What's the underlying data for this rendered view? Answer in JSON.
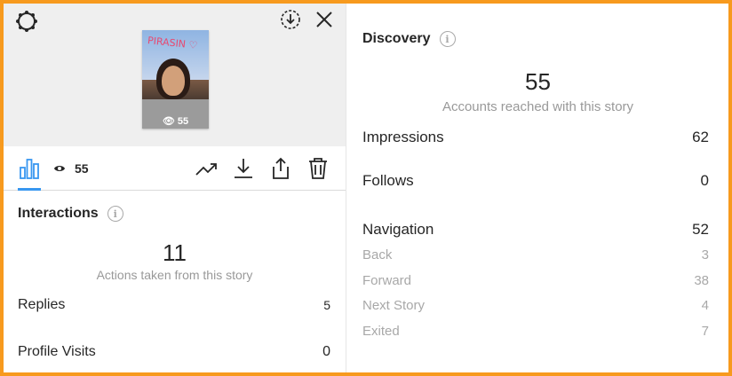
{
  "story": {
    "thumbnail_text": "PIRASIN ♡",
    "views": "55"
  },
  "toolbar": {
    "view_count": "55"
  },
  "interactions": {
    "title": "Interactions",
    "total": "11",
    "subtitle": "Actions taken from this story",
    "rows": [
      {
        "label": "Replies",
        "value": "5"
      },
      {
        "label": "Profile Visits",
        "value": "0"
      }
    ]
  },
  "discovery": {
    "title": "Discovery",
    "reach": "55",
    "subtitle": "Accounts reached with this story",
    "impressions": {
      "label": "Impressions",
      "value": "62"
    },
    "follows": {
      "label": "Follows",
      "value": "0"
    },
    "navigation": {
      "label": "Navigation",
      "value": "52"
    },
    "navigation_breakdown": [
      {
        "label": "Back",
        "value": "3"
      },
      {
        "label": "Forward",
        "value": "38"
      },
      {
        "label": "Next Story",
        "value": "4"
      },
      {
        "label": "Exited",
        "value": "7"
      }
    ]
  },
  "colors": {
    "frame": "#f79a1e",
    "accent": "#3897f0",
    "muted": "#a8a8a8"
  },
  "icons": [
    "settings-icon",
    "download-circle-icon",
    "close-icon",
    "bar-chart-icon",
    "eye-icon",
    "trending-icon",
    "download-icon",
    "share-icon",
    "trash-icon",
    "info-icon"
  ]
}
